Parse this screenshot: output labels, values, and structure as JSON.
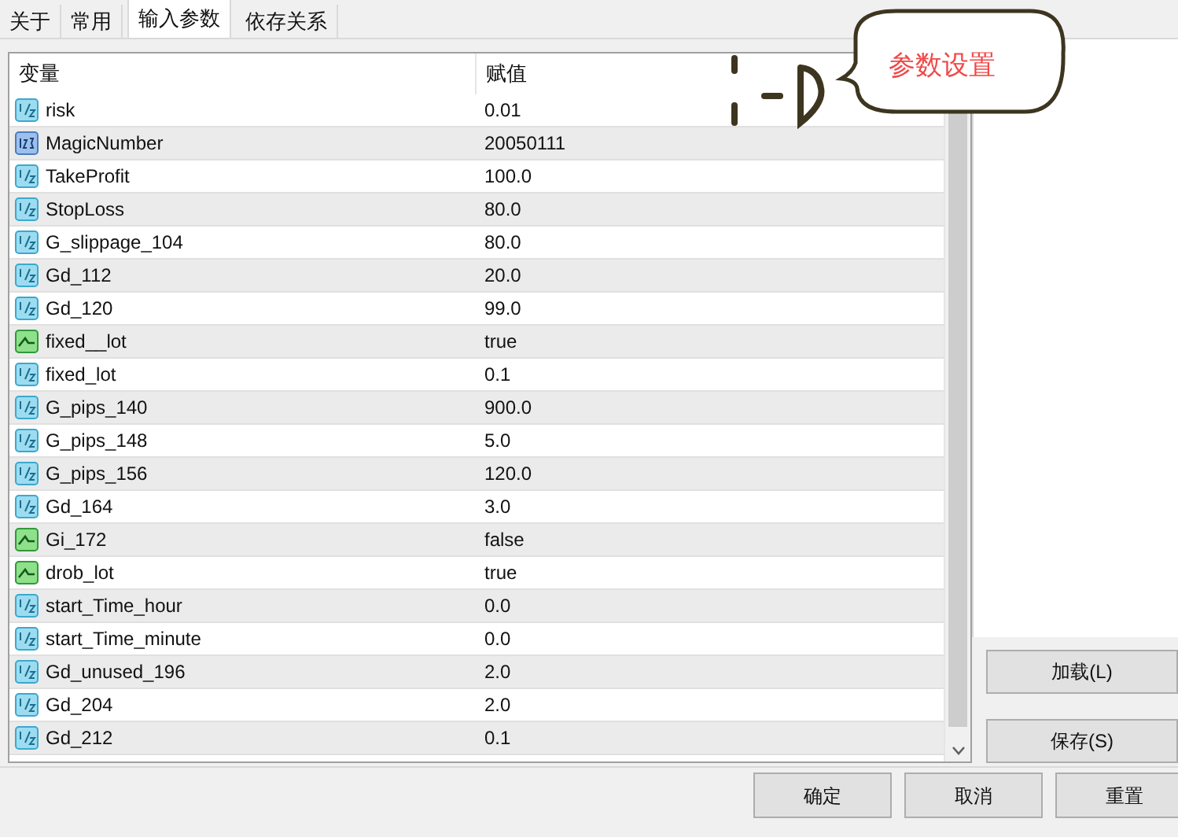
{
  "tabs": [
    {
      "label": "关于",
      "selected": false
    },
    {
      "label": "常用",
      "selected": false
    },
    {
      "label": "输入参数",
      "selected": true
    },
    {
      "label": "依存关系",
      "selected": false
    }
  ],
  "table": {
    "columns": [
      "变量",
      "赋值"
    ],
    "rows": [
      {
        "kind": "double",
        "name": "risk",
        "value": "0.01"
      },
      {
        "kind": "int",
        "name": "MagicNumber",
        "value": "20050111"
      },
      {
        "kind": "double",
        "name": "TakeProfit",
        "value": "100.0"
      },
      {
        "kind": "double",
        "name": "StopLoss",
        "value": "80.0"
      },
      {
        "kind": "double",
        "name": "G_slippage_104",
        "value": "80.0"
      },
      {
        "kind": "double",
        "name": "Gd_112",
        "value": "20.0"
      },
      {
        "kind": "double",
        "name": "Gd_120",
        "value": "99.0"
      },
      {
        "kind": "bool",
        "name": "fixed__lot",
        "value": "true"
      },
      {
        "kind": "double",
        "name": "fixed_lot",
        "value": "0.1"
      },
      {
        "kind": "double",
        "name": "G_pips_140",
        "value": "900.0"
      },
      {
        "kind": "double",
        "name": "G_pips_148",
        "value": "5.0"
      },
      {
        "kind": "double",
        "name": "G_pips_156",
        "value": "120.0"
      },
      {
        "kind": "double",
        "name": "Gd_164",
        "value": "3.0"
      },
      {
        "kind": "bool",
        "name": "Gi_172",
        "value": "false"
      },
      {
        "kind": "bool",
        "name": "drob_lot",
        "value": "true"
      },
      {
        "kind": "double",
        "name": "start_Time_hour",
        "value": "0.0"
      },
      {
        "kind": "double",
        "name": "start_Time_minute",
        "value": "0.0"
      },
      {
        "kind": "double",
        "name": "Gd_unused_196",
        "value": "2.0"
      },
      {
        "kind": "double",
        "name": "Gd_204",
        "value": "2.0"
      },
      {
        "kind": "double",
        "name": "Gd_212",
        "value": "0.1"
      }
    ]
  },
  "callout": {
    "text": "参数设置"
  },
  "side_buttons": [
    "加载(L)",
    "保存(S)"
  ],
  "bottom_buttons": [
    "确定",
    "取消",
    "重置"
  ]
}
